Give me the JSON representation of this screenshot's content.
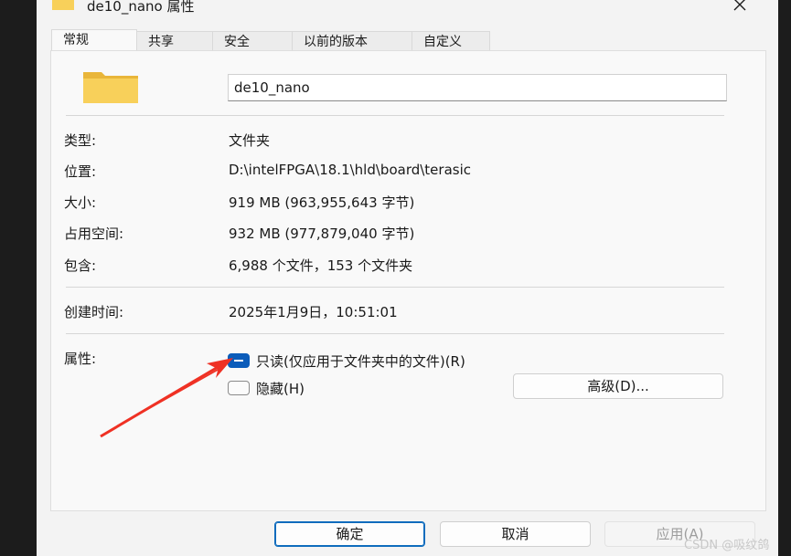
{
  "window": {
    "title": "de10_nano 属性"
  },
  "tabs": [
    {
      "label": "常规"
    },
    {
      "label": "共享"
    },
    {
      "label": "安全"
    },
    {
      "label": "以前的版本"
    },
    {
      "label": "自定义"
    }
  ],
  "general": {
    "name_value": "de10_nano",
    "rows": [
      {
        "label": "类型:",
        "value": "文件夹"
      },
      {
        "label": "位置:",
        "value": "D:\\intelFPGA\\18.1\\hld\\board\\terasic"
      },
      {
        "label": "大小:",
        "value": "919 MB (963,955,643 字节)"
      },
      {
        "label": "占用空间:",
        "value": "932 MB (977,879,040 字节)"
      },
      {
        "label": "包含:",
        "value": "6,988 个文件，153 个文件夹"
      }
    ],
    "created_label": "创建时间:",
    "created_value": "2025年1月9日，10:51:01",
    "attributes_label": "属性:",
    "readonly_label": "只读(仅应用于文件夹中的文件)(R)",
    "hidden_label": "隐藏(H)",
    "advanced_label": "高级(D)..."
  },
  "footer": {
    "ok_label": "确定",
    "cancel_label": "取消",
    "apply_label": "应用(A)"
  },
  "watermark": "CSDN @吸纹鸽",
  "colors": {
    "accent": "#0b5cba",
    "folder": "#f8d05a",
    "arrow": "#ef3124"
  },
  "icons": {
    "folder": "folder-icon",
    "close": "close-icon"
  }
}
